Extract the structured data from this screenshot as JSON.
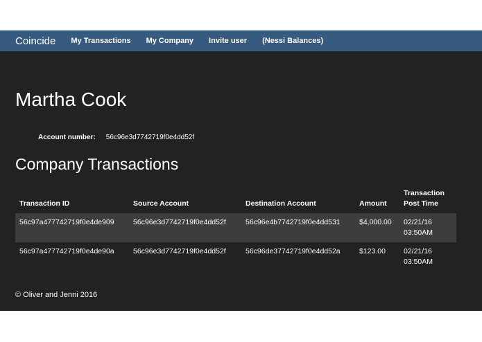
{
  "navbar": {
    "brand": "Coincide",
    "items": [
      {
        "label": "My Transactions"
      },
      {
        "label": "My Company"
      },
      {
        "label": "Invite user"
      },
      {
        "label": "(Nessi Balances)"
      }
    ]
  },
  "page": {
    "title": "Martha Cook",
    "account_label": "Account number:",
    "account_number": "56c96e3d7742719f0e4dd52f",
    "section_title": "Company Transactions"
  },
  "table": {
    "headers": [
      "Transaction ID",
      "Source Account",
      "Destination Account",
      "Amount",
      "Transaction Post Time"
    ],
    "rows": [
      {
        "id": "56c97a477742719f0e4de909",
        "source": "56c96e3d7742719f0e4dd52f",
        "destination": "56c96e4b7742719f0e4dd531",
        "amount": "$4,000.00",
        "date": "02/21/16",
        "time": "03:50AM"
      },
      {
        "id": "56c97a477742719f0e4de90a",
        "source": "56c96e3d7742719f0e4dd52f",
        "destination": "56c96de37742719f0e4dd52a",
        "amount": "$123.00",
        "date": "02/21/16",
        "time": "03:50AM"
      }
    ]
  },
  "footer": {
    "text": "© Oliver and Jenni 2016"
  },
  "colors": {
    "navbar": "#375a7f",
    "body": "#222222",
    "row_stripe": "#3d3d3d"
  }
}
